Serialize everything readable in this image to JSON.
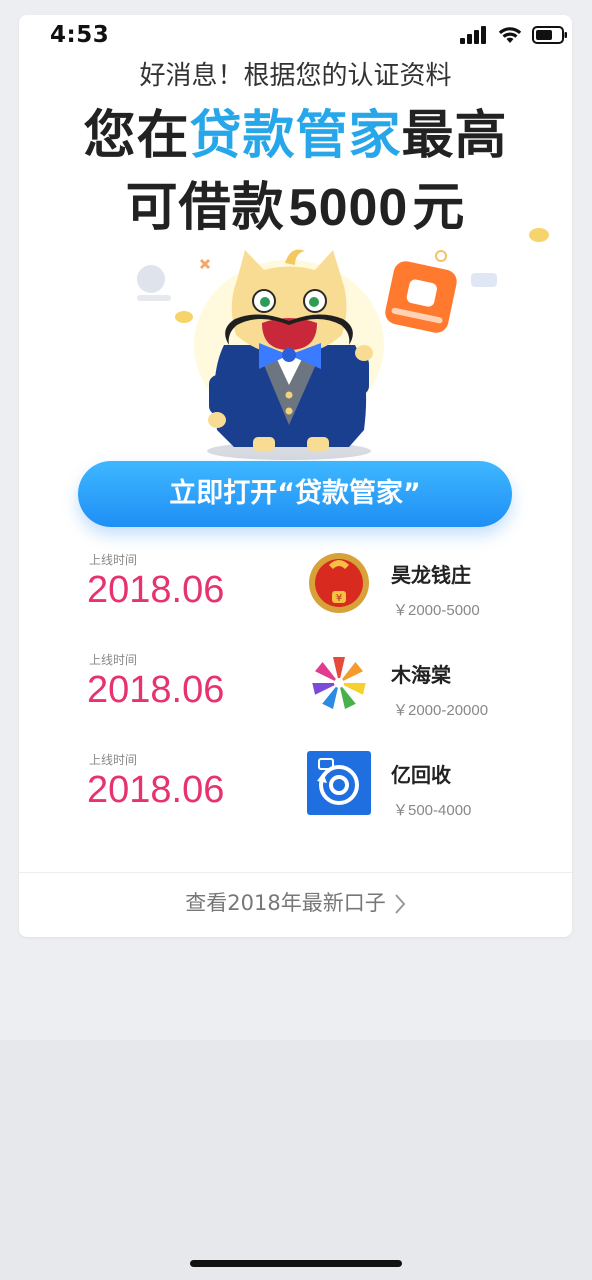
{
  "status": {
    "time": "4:53"
  },
  "headline": {
    "small": "好消息！根据您的认证资料",
    "line1_pre": "您在",
    "line1_app": "贷款管家",
    "line1_post": "最高",
    "line2_pre": "可借款",
    "line2_amount": "5000",
    "line2_unit": "元"
  },
  "cta": {
    "label": "立即打开“贷款管家”"
  },
  "lenders": [
    {
      "online_label": "上线时间",
      "date": "2018.06",
      "name": "昊龙钱庄",
      "range": "￥2000-5000"
    },
    {
      "online_label": "上线时间",
      "date": "2018.06",
      "name": "木海棠",
      "range": "￥2000-20000"
    },
    {
      "online_label": "上线时间",
      "date": "2018.06",
      "name": "亿回收",
      "range": "￥500-4000"
    }
  ],
  "footer": {
    "label": "查看2018年最新口子"
  },
  "colors": {
    "accent": "#27a7ea",
    "cta": "#2196f3",
    "date": "#e6336e"
  }
}
